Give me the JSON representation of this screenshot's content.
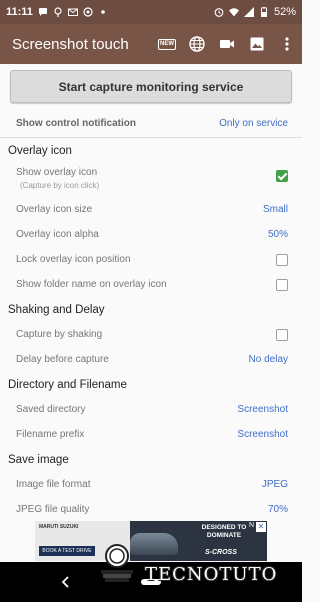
{
  "status_bar": {
    "time": "11:11",
    "battery": "52%",
    "left_icons": [
      "message-icon",
      "location-icon",
      "mail-icon",
      "whatsapp-icon",
      "dot-icon"
    ],
    "right_icons": [
      "alarm-icon",
      "wifi-icon",
      "signal-icon",
      "battery-icon"
    ]
  },
  "app_bar": {
    "title": "Screenshot touch",
    "new_badge": "NEW",
    "actions": [
      "new-icon",
      "globe-icon",
      "videocam-icon",
      "image-icon",
      "more-icon"
    ]
  },
  "start_button": "Start capture monitoring service",
  "notification": {
    "label": "Show control notification",
    "value": "Only on service"
  },
  "sections": {
    "overlay": {
      "title": "Overlay icon",
      "show_overlay": {
        "label": "Show overlay icon",
        "sub": "(Capture by icon click)",
        "checked": true
      },
      "size": {
        "label": "Overlay icon size",
        "value": "Small"
      },
      "alpha": {
        "label": "Overlay icon alpha",
        "value": "50%"
      },
      "lock": {
        "label": "Lock overlay icon position",
        "checked": false
      },
      "folder": {
        "label": "Show folder name on overlay icon",
        "checked": false
      }
    },
    "shaking": {
      "title": "Shaking and Delay",
      "capture_shaking": {
        "label": "Capture by shaking",
        "checked": false
      },
      "delay": {
        "label": "Delay before capture",
        "value": "No delay"
      }
    },
    "directory": {
      "title": "Directory and Filename",
      "saved_dir": {
        "label": "Saved directory",
        "value": "Screenshot"
      },
      "prefix": {
        "label": "Filename prefix",
        "value": "Screenshot"
      }
    },
    "save_image": {
      "title": "Save image",
      "format": {
        "label": "Image file format",
        "value": "JPEG"
      },
      "quality": {
        "label": "JPEG file quality",
        "value": "70%"
      }
    }
  },
  "ad": {
    "brand": "MARUTI SUZUKI",
    "cta": "BOOK A TEST DRIVE",
    "tagline": "DESIGNED TO DOMINATE",
    "model": "S-CROSS",
    "info": "N",
    "close": "✕"
  },
  "watermark": "TECNOTUTO",
  "colors": {
    "app_bar": "#795548",
    "status_bar": "#6d4c41",
    "accent": "#3f6ec6",
    "checkbox_on": "#43a047"
  }
}
